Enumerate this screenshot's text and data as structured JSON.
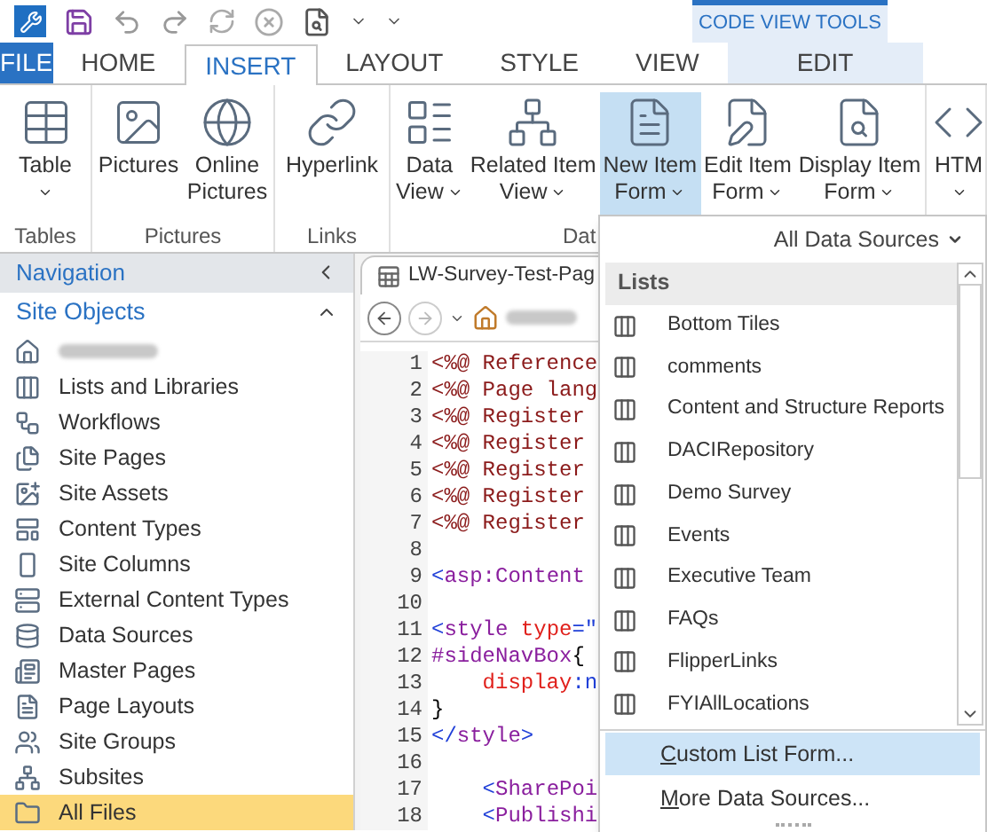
{
  "context_group": {
    "title": "CODE VIEW TOOLS"
  },
  "tabs": [
    {
      "label": "FILE",
      "kind": "file",
      "selected": false
    },
    {
      "label": "HOME",
      "kind": "normal",
      "selected": false
    },
    {
      "label": "INSERT",
      "kind": "normal",
      "selected": true
    },
    {
      "label": "LAYOUT",
      "kind": "normal",
      "selected": false
    },
    {
      "label": "STYLE",
      "kind": "normal",
      "selected": false
    },
    {
      "label": "VIEW",
      "kind": "normal",
      "selected": false
    },
    {
      "label": "EDIT",
      "kind": "contextual",
      "selected": false
    }
  ],
  "ribbon_groups": [
    {
      "label": "Tables",
      "buttons": [
        {
          "lines": [
            "Table"
          ],
          "dropdown": true,
          "pressed": false
        }
      ]
    },
    {
      "label": "Pictures",
      "buttons": [
        {
          "lines": [
            "Pictures"
          ],
          "dropdown": false,
          "pressed": false
        },
        {
          "lines": [
            "Online",
            "Pictures"
          ],
          "dropdown": false,
          "pressed": false
        }
      ]
    },
    {
      "label": "Links",
      "buttons": [
        {
          "lines": [
            "Hyperlink"
          ],
          "dropdown": false,
          "pressed": false
        }
      ]
    },
    {
      "label": "Dat",
      "buttons": [
        {
          "lines": [
            "Data",
            "View"
          ],
          "dropdown": true,
          "pressed": false
        },
        {
          "lines": [
            "Related Item",
            "View"
          ],
          "dropdown": true,
          "pressed": false
        },
        {
          "lines": [
            "New Item",
            "Form"
          ],
          "dropdown": true,
          "pressed": true
        },
        {
          "lines": [
            "Edit Item",
            "Form"
          ],
          "dropdown": true,
          "pressed": false
        },
        {
          "lines": [
            "Display Item",
            "Form"
          ],
          "dropdown": true,
          "pressed": false
        }
      ]
    },
    {
      "buttons": [
        {
          "lines": [
            "HTM"
          ],
          "dropdown": true,
          "pressed": false
        }
      ]
    }
  ],
  "navigation": {
    "title": "Navigation",
    "section": "Site Objects",
    "items": [
      {
        "kind": "redacted",
        "selected": false
      },
      {
        "label": "Lists and Libraries",
        "kind": "item",
        "selected": false
      },
      {
        "label": "Workflows",
        "kind": "item",
        "selected": false
      },
      {
        "label": "Site Pages",
        "kind": "item",
        "selected": false
      },
      {
        "label": "Site Assets",
        "kind": "item",
        "selected": false
      },
      {
        "label": "Content Types",
        "kind": "item",
        "selected": false
      },
      {
        "label": "Site Columns",
        "kind": "item",
        "selected": false
      },
      {
        "label": "External Content Types",
        "kind": "item",
        "selected": false
      },
      {
        "label": "Data Sources",
        "kind": "item",
        "selected": false
      },
      {
        "label": "Master Pages",
        "kind": "item",
        "selected": false
      },
      {
        "label": "Page Layouts",
        "kind": "item",
        "selected": false
      },
      {
        "label": "Site Groups",
        "kind": "item",
        "selected": false
      },
      {
        "label": "Subsites",
        "kind": "item",
        "selected": false
      },
      {
        "label": "All Files",
        "kind": "item",
        "selected": true
      }
    ]
  },
  "editor": {
    "tab_title": "LW-Survey-Test-Pag",
    "code_lines": [
      {
        "number": "1",
        "tokens": [
          {
            "text": "<%@ Reference",
            "kind": "directive"
          }
        ]
      },
      {
        "number": "2",
        "tokens": [
          {
            "text": "<%@ Page lang",
            "kind": "directive"
          }
        ]
      },
      {
        "number": "3",
        "tokens": [
          {
            "text": "<%@ Register",
            "kind": "directive"
          }
        ]
      },
      {
        "number": "4",
        "tokens": [
          {
            "text": "<%@ Register",
            "kind": "directive"
          }
        ]
      },
      {
        "number": "5",
        "tokens": [
          {
            "text": "<%@ Register",
            "kind": "directive"
          }
        ]
      },
      {
        "number": "6",
        "tokens": [
          {
            "text": "<%@ Register",
            "kind": "directive"
          }
        ]
      },
      {
        "number": "7",
        "tokens": [
          {
            "text": "<%@ Register",
            "kind": "directive"
          }
        ]
      },
      {
        "number": "8"
      },
      {
        "number": "9",
        "tokens": [
          {
            "text": "<",
            "kind": "bracket"
          },
          {
            "text": "asp:Content",
            "kind": "tag"
          }
        ]
      },
      {
        "number": "10"
      },
      {
        "number": "11",
        "tokens": [
          {
            "text": "<",
            "kind": "bracket"
          },
          {
            "text": "style",
            "kind": "tag"
          },
          {
            "text": " type",
            "kind": "attr"
          },
          {
            "text": "=\"",
            "kind": "bracket"
          }
        ]
      },
      {
        "number": "12",
        "tokens": [
          {
            "text": "#sideNavBox",
            "kind": "tag"
          },
          {
            "text": "{",
            "kind": "plain"
          }
        ]
      },
      {
        "number": "13",
        "tokens": [
          {
            "text": "    display",
            "kind": "attr"
          },
          {
            "text": ":n",
            "kind": "bracket"
          }
        ]
      },
      {
        "number": "14",
        "tokens": [
          {
            "text": "}",
            "kind": "plain"
          }
        ]
      },
      {
        "number": "15",
        "tokens": [
          {
            "text": "</",
            "kind": "bracket"
          },
          {
            "text": "style",
            "kind": "tag"
          },
          {
            "text": ">",
            "kind": "bracket"
          }
        ]
      },
      {
        "number": "16"
      },
      {
        "number": "17",
        "tokens": [
          {
            "text": "    <",
            "kind": "bracket"
          },
          {
            "text": "SharePoi",
            "kind": "tag"
          }
        ]
      },
      {
        "number": "18",
        "tokens": [
          {
            "text": "    <",
            "kind": "bracket"
          },
          {
            "text": "Publishi",
            "kind": "tag"
          }
        ]
      }
    ]
  },
  "dropdown": {
    "filter": "All Data Sources",
    "header": "Lists",
    "items": [
      "Bottom Tiles",
      "comments",
      "Content and Structure Reports",
      "DACIRepository",
      "Demo Survey",
      "Events",
      "Executive Team",
      "FAQs",
      "FlipperLinks",
      "FYIAllLocations"
    ],
    "actions": [
      {
        "key": "C",
        "rest": "ustom List Form...",
        "selected": true
      },
      {
        "key": "M",
        "rest": "ore Data Sources...",
        "selected": false
      }
    ]
  }
}
